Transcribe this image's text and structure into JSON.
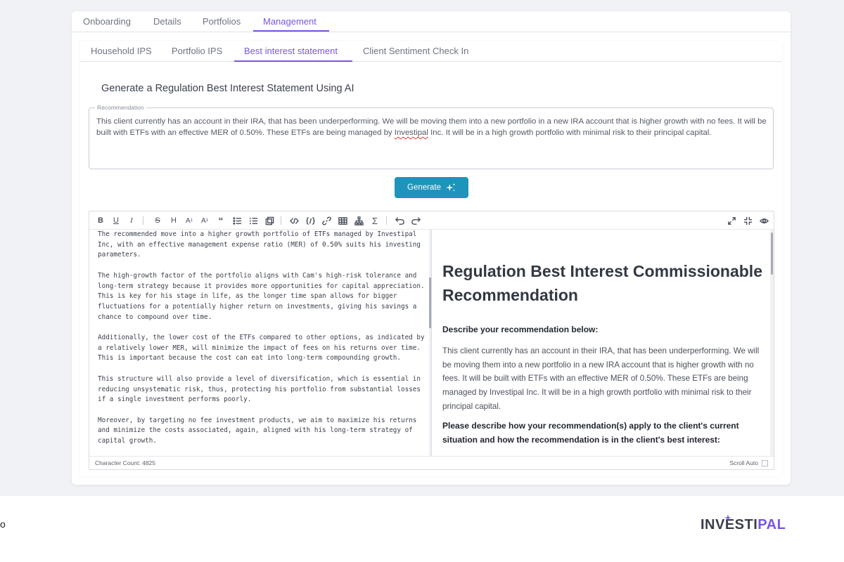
{
  "main_tabs": [
    {
      "label": "Onboarding",
      "active": false
    },
    {
      "label": "Details",
      "active": false
    },
    {
      "label": "Portfolios",
      "active": false
    },
    {
      "label": "Management",
      "active": true
    }
  ],
  "sub_tabs": [
    {
      "label": "Household IPS",
      "active": false
    },
    {
      "label": "Portfolio IPS",
      "active": false
    },
    {
      "label": "Best interest statement",
      "active": true
    },
    {
      "label": "Client Sentiment Check In",
      "active": false
    }
  ],
  "section_title": "Generate a Regulation Best Interest Statement Using AI",
  "recommendation": {
    "legend": "Recommendation",
    "text_before": "This client currently has an account in their IRA, that has been underperforming. We will be moving them into a new portfolio in a new IRA account that is higher growth with no fees. It will be built with ETFs with an effective MER of 0.50%. These ETFs are being managed by ",
    "text_flagged": "Investipal",
    "text_after": " Inc. It will be in a high growth portfolio with minimal risk to their principal capital."
  },
  "generate_button": {
    "label": "Generate",
    "icon": "sparkle-icon"
  },
  "toolbar": {
    "items": [
      "bold",
      "underline",
      "italic",
      "strikethrough",
      "heading",
      "font-size-down",
      "font-size-up",
      "quote",
      "unordered-list",
      "ordered-list",
      "checklist",
      "code",
      "inline-code",
      "link",
      "table",
      "tree",
      "sum",
      "undo",
      "redo"
    ],
    "right_items": [
      "fullscreen",
      "fullscreen-exit",
      "preview-eye"
    ]
  },
  "source_paragraphs": [
    "The recommended move into a higher growth portfolio of ETFs managed by Investipal Inc, with an effective management expense ratio (MER) of 0.50% suits his investing parameters.",
    "The high-growth factor of the portfolio aligns with Cam's high-risk tolerance and long-term strategy because it provides more opportunities for capital appreciation. This is key for his stage in life, as the longer time span allows for bigger fluctuations for a potentially higher return on investments, giving his savings a chance to compound over time.",
    "Additionally, the lower cost of the ETFs compared to other options, as indicated by a relatively lower MER, will minimize the impact of fees on his returns over time. This is important because the cost can eat into long-term compounding growth.",
    "This structure will also provide a level of diversification, which is essential in reducing unsystematic risk, thus, protecting his portfolio from substantial losses if a single investment performs poorly.",
    "Moreover, by targeting no fee investment products, we aim to maximize his returns and minimize the costs associated, again, aligned with his long-term strategy of capital growth."
  ],
  "preview": {
    "heading": "Regulation Best Interest Commissionable Recommendation",
    "subheading": "Describe your recommendation below:",
    "paragraph": "This client currently has an account in their IRA, that has been underperforming. We will be moving them into a new portfolio in a new IRA account that is higher growth with no fees. It will be built with ETFs with an effective MER of 0.50%. These ETFs are being managed by Investipal Inc. It will be in a high growth portfolio with minimal risk to their principal capital.",
    "question": "Please describe how your recommendation(s) apply to the client's current situation and how the recommendation is in the client's best interest:"
  },
  "status": {
    "char_count": "Character Count: 4825",
    "scroll_auto": "Scroll Auto"
  },
  "footer": {
    "left_text": "o",
    "logo_left": "INVESTI",
    "logo_right": "PAL"
  },
  "colors": {
    "accent": "#7a55e0",
    "button": "#1e94bc"
  }
}
